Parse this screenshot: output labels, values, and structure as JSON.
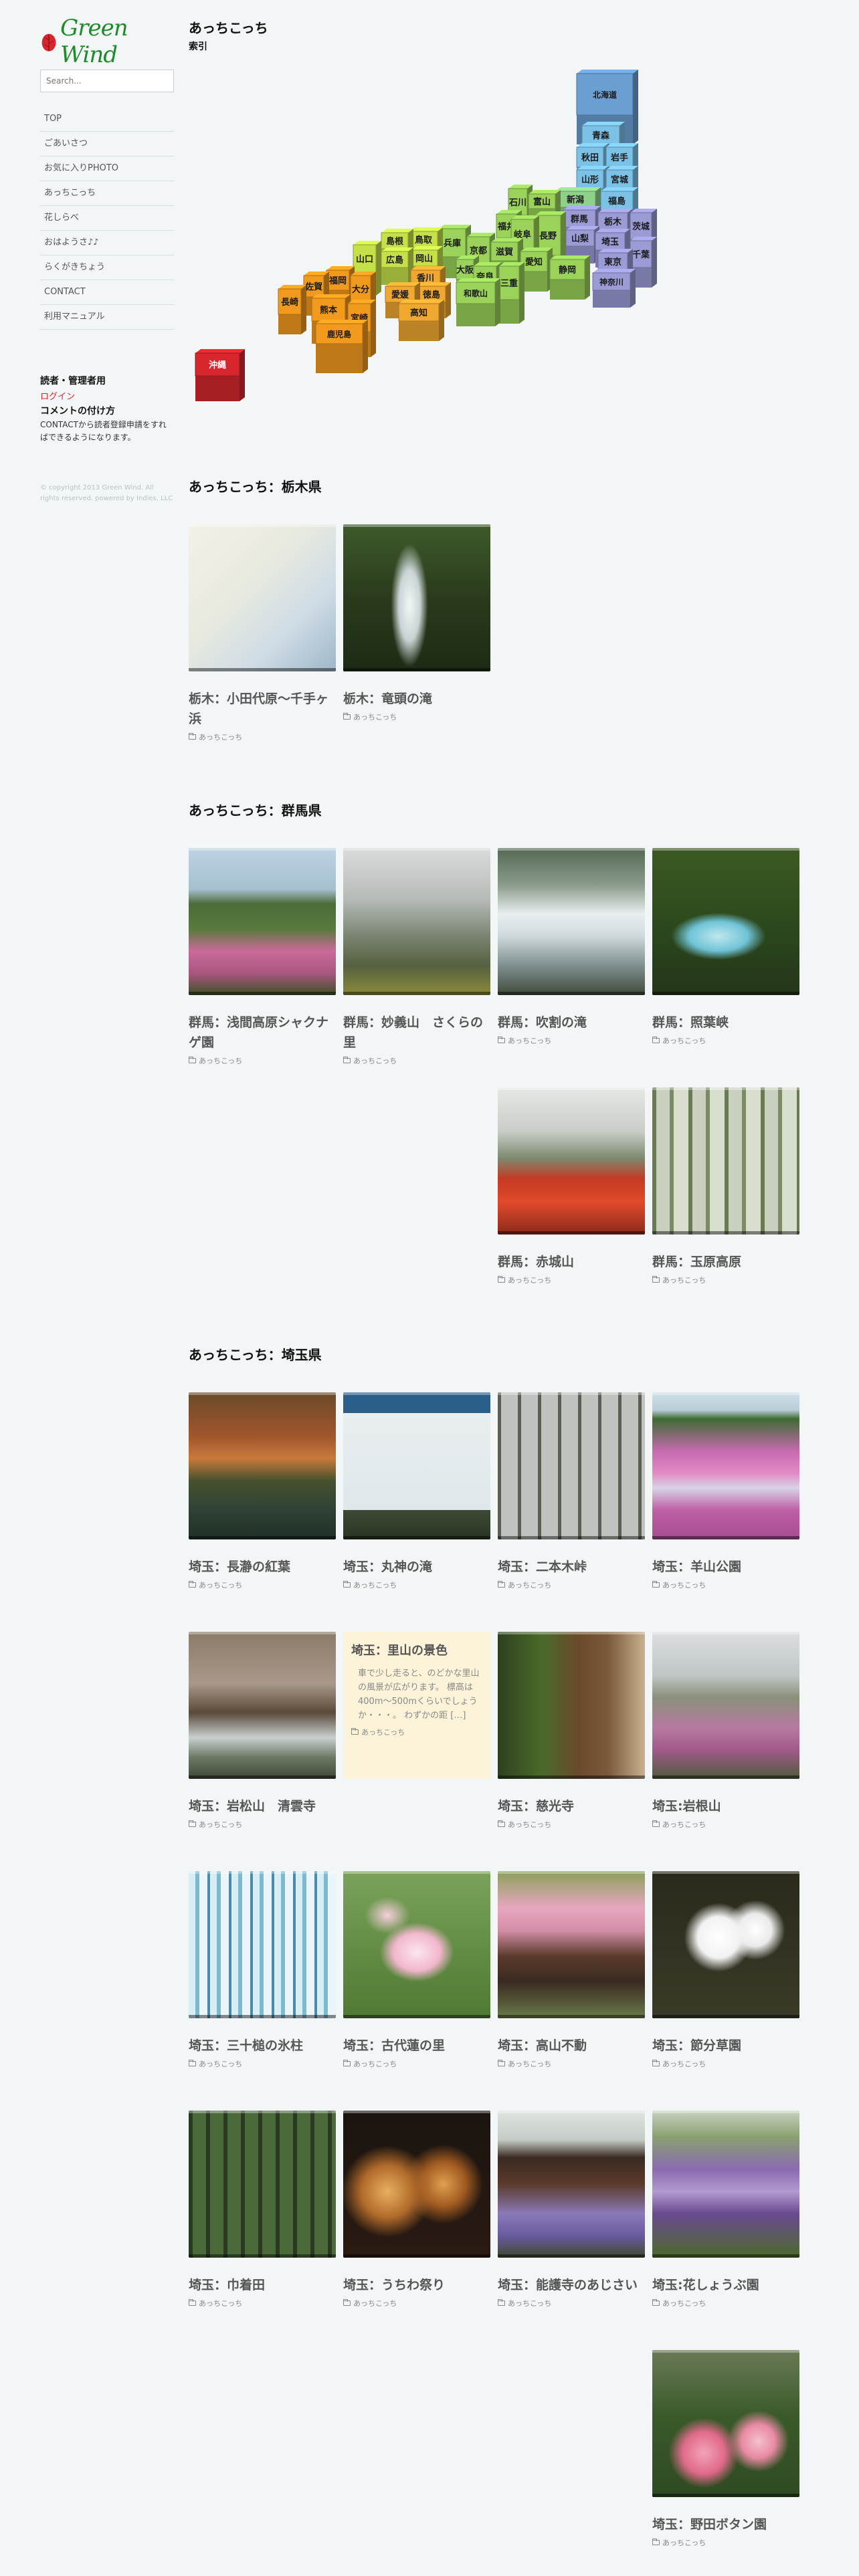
{
  "site": {
    "logo_text": "Green Wind"
  },
  "search": {
    "placeholder": "Search..."
  },
  "nav": [
    {
      "label": "TOP"
    },
    {
      "label": "ごあいさつ"
    },
    {
      "label": "お気に入りPHOTO"
    },
    {
      "label": "あっちこっち"
    },
    {
      "label": "花しらべ"
    },
    {
      "label": "おはようさ♪♪"
    },
    {
      "label": "らくがきちょう"
    },
    {
      "label": "CONTACT"
    },
    {
      "label": "利用マニュアル"
    }
  ],
  "reader_box": {
    "heading": "読者・管理者用",
    "login": "ログイン",
    "comment_heading": "コメントの付け方",
    "comment_text": "CONTACTから読者登録申請をすればできるようになります。"
  },
  "copyright": "© copyright 2013 Green Wind. All rights reserved. powered by Indies, LLC",
  "main": {
    "title": "あっちこっち",
    "subtitle": "索引"
  },
  "map": {
    "prefectures": [
      {
        "name": "北海道",
        "color": "#6b9fd4"
      },
      {
        "name": "青森",
        "color": "#7cc1e6"
      },
      {
        "name": "秋田",
        "color": "#7cc1e6"
      },
      {
        "name": "岩手",
        "color": "#7cc1e6"
      },
      {
        "name": "山形",
        "color": "#7cc1e6"
      },
      {
        "name": "宮城",
        "color": "#7cc1e6"
      },
      {
        "name": "福島",
        "color": "#7cc1e6"
      },
      {
        "name": "新潟",
        "color": "#8fd18a"
      },
      {
        "name": "富山",
        "color": "#9ad25a"
      },
      {
        "name": "石川",
        "color": "#9ad25a"
      },
      {
        "name": "福井",
        "color": "#9ad25a"
      },
      {
        "name": "群馬",
        "color": "#9b9bd6"
      },
      {
        "name": "栃木",
        "color": "#9b9bd6"
      },
      {
        "name": "茨城",
        "color": "#9b9bd6"
      },
      {
        "name": "長野",
        "color": "#9ad25a"
      },
      {
        "name": "岐阜",
        "color": "#9ad25a"
      },
      {
        "name": "山梨",
        "color": "#9b9bd6"
      },
      {
        "name": "埼玉",
        "color": "#9b9bd6"
      },
      {
        "name": "千葉",
        "color": "#9b9bd6"
      },
      {
        "name": "東京",
        "color": "#9b9bd6"
      },
      {
        "name": "神奈川",
        "color": "#9b9bd6"
      },
      {
        "name": "静岡",
        "color": "#9ad25a"
      },
      {
        "name": "愛知",
        "color": "#9ad25a"
      },
      {
        "name": "滋賀",
        "color": "#9ad25a"
      },
      {
        "name": "京都",
        "color": "#9ad25a"
      },
      {
        "name": "兵庫",
        "color": "#9ad25a"
      },
      {
        "name": "奈良",
        "color": "#9ad25a"
      },
      {
        "name": "三重",
        "color": "#9ad25a"
      },
      {
        "name": "大阪",
        "color": "#9ad25a"
      },
      {
        "name": "和歌山",
        "color": "#9ad25a"
      },
      {
        "name": "鳥取",
        "color": "#c6e04a"
      },
      {
        "name": "島根",
        "color": "#c6e04a"
      },
      {
        "name": "岡山",
        "color": "#c6e04a"
      },
      {
        "name": "広島",
        "color": "#c6e04a"
      },
      {
        "name": "山口",
        "color": "#c6e04a"
      },
      {
        "name": "香川",
        "color": "#f0a830"
      },
      {
        "name": "徳島",
        "color": "#f0a830"
      },
      {
        "name": "愛媛",
        "color": "#f0a830"
      },
      {
        "name": "高知",
        "color": "#f0a830"
      },
      {
        "name": "福岡",
        "color": "#f29a1e"
      },
      {
        "name": "大分",
        "color": "#f29a1e"
      },
      {
        "name": "佐賀",
        "color": "#f29a1e"
      },
      {
        "name": "長崎",
        "color": "#f29a1e"
      },
      {
        "name": "熊本",
        "color": "#f29a1e"
      },
      {
        "name": "宮崎",
        "color": "#f29a1e"
      },
      {
        "name": "鹿児島",
        "color": "#f29a1e"
      },
      {
        "name": "沖縄",
        "color": "#d8262f"
      }
    ]
  },
  "sections": [
    {
      "heading": "あっちこっち：栃木県",
      "posts": [
        {
          "title": "栃木：小田代原〜千手ヶ浜",
          "category": "あっちこっち",
          "image": "map-photo"
        },
        {
          "title": "栃木：竜頭の滝",
          "category": "あっちこっち",
          "image": "waterfall-forest"
        }
      ]
    },
    {
      "heading": "あっちこっち：群馬県",
      "posts": [
        {
          "title": "群馬：浅間高原シャクナゲ園",
          "category": "あっちこっち",
          "image": "rhododendron-garden"
        },
        {
          "title": "群馬：妙義山　さくらの里",
          "category": "あっちこっち",
          "image": "misty-mountain"
        },
        {
          "title": "群馬：吹割の滝",
          "category": "あっちこっち",
          "image": "wide-waterfall"
        },
        {
          "title": "群馬：照葉峡",
          "category": "あっちこっち",
          "image": "stream-cascade"
        },
        {
          "title": "群馬：赤城山",
          "category": "あっちこっち",
          "image": "red-azalea-hill"
        },
        {
          "title": "群馬：玉原高原",
          "category": "あっちこっち",
          "image": "beech-forest"
        }
      ]
    },
    {
      "heading": "あっちこっち：埼玉県",
      "posts": [
        {
          "title": "埼玉：長瀞の紅葉",
          "category": "あっちこっち",
          "image": "autumn-river"
        },
        {
          "title": "埼玉：丸神の滝",
          "category": "あっちこっち",
          "image": "guide-board"
        },
        {
          "title": "埼玉：二本木峠",
          "category": "あっちこっち",
          "image": "foggy-trees"
        },
        {
          "title": "埼玉：羊山公園",
          "category": "あっちこっち",
          "image": "moss-phlox"
        },
        {
          "title": "埼玉：岩松山　清雲寺",
          "category": "あっちこっち",
          "image": "temple-sakura"
        },
        {
          "title": "埼玉：里山の景色",
          "category": "あっちこっち",
          "excerpt": "車で少し走ると、のどかな里山の風景が広がります。 標高は400m〜500mくらいでしょうか・・・。 わずかの距 […]",
          "text_only": true
        },
        {
          "title": "埼玉：慈光寺",
          "category": "あっちこっち",
          "image": "temple-gate"
        },
        {
          "title": "埼玉:岩根山",
          "category": "あっちこっち",
          "image": "pink-hill-mist"
        },
        {
          "title": "埼玉：三十槌の氷柱",
          "category": "あっちこっち",
          "image": "icicles"
        },
        {
          "title": "埼玉：古代蓮の里",
          "category": "あっちこっち",
          "image": "lotus"
        },
        {
          "title": "埼玉：高山不動",
          "category": "あっちこっち",
          "image": "temple-roof"
        },
        {
          "title": "埼玉：節分草園",
          "category": "あっちこっち",
          "image": "white-flowers"
        },
        {
          "title": "埼玉：巾着田",
          "category": "あっちこっち",
          "image": "red-lilies"
        },
        {
          "title": "埼玉：うちわ祭り",
          "category": "あっちこっち",
          "image": "festival-night"
        },
        {
          "title": "埼玉：能護寺のあじさい",
          "category": "あっちこっち",
          "image": "hydrangea-pagoda"
        },
        {
          "title": "埼玉:花しょうぶ園",
          "category": "あっちこっち",
          "image": "iris-field"
        },
        {
          "title": "埼玉：野田ボタン園",
          "category": "あっちこっち",
          "image": "peony-garden"
        }
      ]
    }
  ]
}
